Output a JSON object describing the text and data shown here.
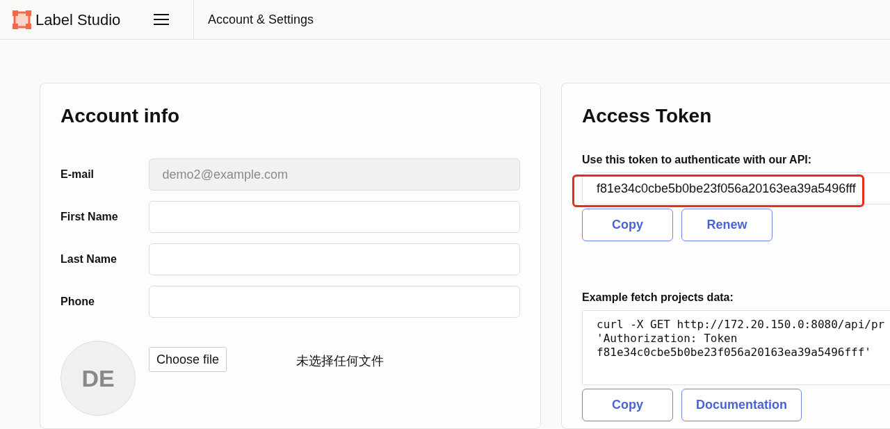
{
  "header": {
    "brand": "Label Studio",
    "title": "Account & Settings"
  },
  "account_info": {
    "title": "Account info",
    "fields": [
      {
        "label": "E-mail",
        "value": "demo2@example.com",
        "disabled": true
      },
      {
        "label": "First Name",
        "disabled": false
      },
      {
        "label": "Last Name",
        "disabled": false
      },
      {
        "label": "Phone",
        "disabled": false
      }
    ],
    "avatar": {
      "initials": "DE",
      "file_button": "Choose file",
      "file_status": "未选择任何文件"
    }
  },
  "access_token": {
    "title": "Access Token",
    "token_label": "Use this token to authenticate with our API:",
    "token": "f81e34c0cbe5b0be23f056a20163ea39a5496fff",
    "token_highlighted": true,
    "token_buttons": [
      "Copy",
      "Renew"
    ],
    "example_label": "Example fetch projects data:",
    "example_lines": [
      "curl -X GET http://172.20.150.0:8080/api/pr",
      "'Authorization: Token",
      "f81e34c0cbe5b0be23f056a20163ea39a5496fff'"
    ],
    "example_buttons": [
      "Copy",
      "Documentation"
    ]
  }
}
